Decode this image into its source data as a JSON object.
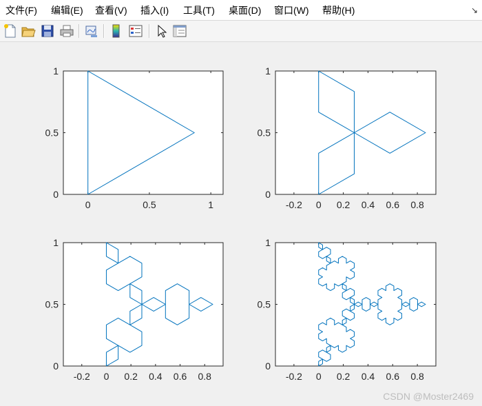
{
  "menu": {
    "items": [
      {
        "id": "file",
        "label": "文件(F)"
      },
      {
        "id": "edit",
        "label": "编辑(E)"
      },
      {
        "id": "view",
        "label": "查看(V)"
      },
      {
        "id": "insert",
        "label": "插入(I)"
      },
      {
        "id": "tools",
        "label": "工具(T)"
      },
      {
        "id": "desktop",
        "label": "桌面(D)"
      },
      {
        "id": "window",
        "label": "窗口(W)"
      },
      {
        "id": "help",
        "label": "帮助(H)"
      }
    ],
    "restore_icon": "restore-arrow-icon"
  },
  "toolbar": {
    "buttons": [
      {
        "id": "new",
        "icon": "new-figure-icon"
      },
      {
        "id": "open",
        "icon": "open-folder-icon"
      },
      {
        "id": "save",
        "icon": "save-icon"
      },
      {
        "id": "print",
        "icon": "print-icon"
      },
      {
        "id": "link",
        "icon": "link-plot-icon"
      },
      {
        "id": "colorbar",
        "icon": "colorbar-icon"
      },
      {
        "id": "legend",
        "icon": "legend-icon"
      },
      {
        "id": "pointer",
        "icon": "pointer-arrow-icon"
      },
      {
        "id": "property",
        "icon": "property-inspector-icon"
      }
    ]
  },
  "chart_data": [
    {
      "type": "line",
      "title": "",
      "xlabel": "",
      "ylabel": "",
      "xlim": [
        -0.2,
        1.1
      ],
      "ylim": [
        0,
        1
      ],
      "xticks": [
        "0",
        "0.5",
        "1"
      ],
      "xtick_values": [
        0,
        0.5,
        1
      ],
      "yticks": [
        "0",
        "0.5",
        "1"
      ],
      "ytick_values": [
        0,
        0.5,
        1
      ],
      "koch_iterations": 0,
      "series": [
        {
          "color": "#0072bd",
          "shape": "Koch snowflake, iteration 0 (equilateral triangle)",
          "x": [
            0,
            0,
            0.866,
            0
          ],
          "y": [
            0,
            1,
            0.5,
            0
          ]
        }
      ]
    },
    {
      "type": "line",
      "title": "",
      "xlabel": "",
      "ylabel": "",
      "xlim": [
        -0.35,
        0.95
      ],
      "ylim": [
        0,
        1
      ],
      "xticks": [
        "-0.2",
        "0",
        "0.2",
        "0.4",
        "0.6",
        "0.8"
      ],
      "xtick_values": [
        -0.2,
        0,
        0.2,
        0.4,
        0.6,
        0.8
      ],
      "yticks": [
        "0",
        "0.5",
        "1"
      ],
      "ytick_values": [
        0,
        0.5,
        1
      ],
      "koch_iterations": 1,
      "series": [
        {
          "color": "#0072bd",
          "shape": "Koch snowflake, iteration 1 (six-pointed star)"
        }
      ]
    },
    {
      "type": "line",
      "title": "",
      "xlabel": "",
      "ylabel": "",
      "xlim": [
        -0.35,
        0.95
      ],
      "ylim": [
        0,
        1
      ],
      "xticks": [
        "-0.2",
        "0",
        "0.2",
        "0.4",
        "0.6",
        "0.8"
      ],
      "xtick_values": [
        -0.2,
        0,
        0.2,
        0.4,
        0.6,
        0.8
      ],
      "yticks": [
        "0",
        "0.5",
        "1"
      ],
      "ytick_values": [
        0,
        0.5,
        1
      ],
      "koch_iterations": 2,
      "series": [
        {
          "color": "#0072bd",
          "shape": "Koch snowflake, iteration 2"
        }
      ]
    },
    {
      "type": "line",
      "title": "",
      "xlabel": "",
      "ylabel": "",
      "xlim": [
        -0.35,
        0.95
      ],
      "ylim": [
        0,
        1
      ],
      "xticks": [
        "-0.2",
        "0",
        "0.2",
        "0.4",
        "0.6",
        "0.8"
      ],
      "xtick_values": [
        -0.2,
        0,
        0.2,
        0.4,
        0.6,
        0.8
      ],
      "yticks": [
        "0",
        "0.5",
        "1"
      ],
      "ytick_values": [
        0,
        0.5,
        1
      ],
      "koch_iterations": 3,
      "series": [
        {
          "color": "#0072bd",
          "shape": "Koch snowflake, iteration 3"
        }
      ]
    }
  ],
  "watermark": "CSDN @Moster2469"
}
